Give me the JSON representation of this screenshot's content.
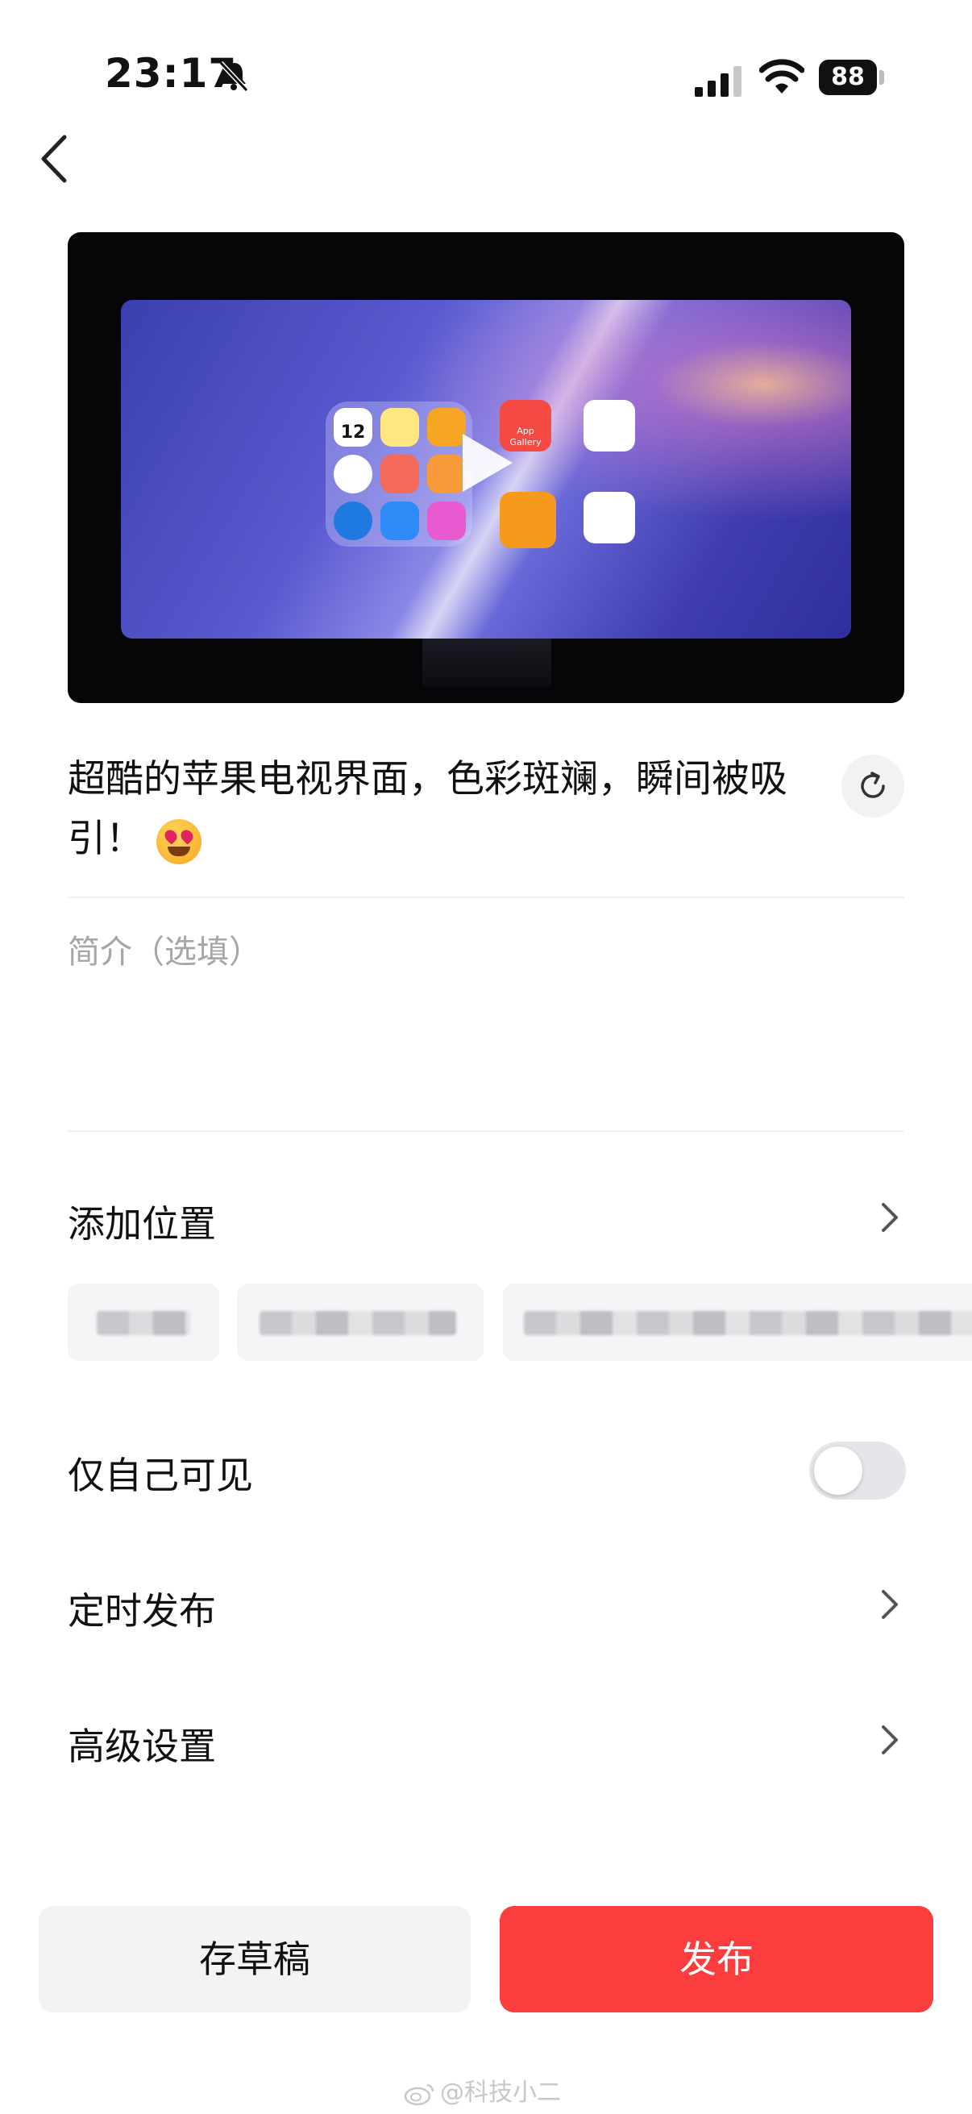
{
  "status_bar": {
    "time": "23:17",
    "battery": "88"
  },
  "nav": {
    "back_icon": "chevron-left-icon"
  },
  "video": {
    "app_gallery_label": "App Gallery",
    "calendar_day": "12"
  },
  "post": {
    "title": "超酷的苹果电视界面，色彩斑斓，瞬间被吸引！",
    "title_emoji": "heart-eyes-emoji",
    "description_placeholder": "简介（选填）"
  },
  "settings": {
    "add_location": "添加位置",
    "visible_only_me": "仅自己可见",
    "visible_only_me_on": false,
    "scheduled_publish": "定时发布",
    "advanced_settings": "高级设置"
  },
  "actions": {
    "save_draft": "存草稿",
    "publish": "发布"
  },
  "watermark": {
    "text": "@科技小二"
  },
  "colors": {
    "accent": "#fb3d3d",
    "draft_bg": "#f3f3f5",
    "placeholder": "#a5a5aa"
  }
}
